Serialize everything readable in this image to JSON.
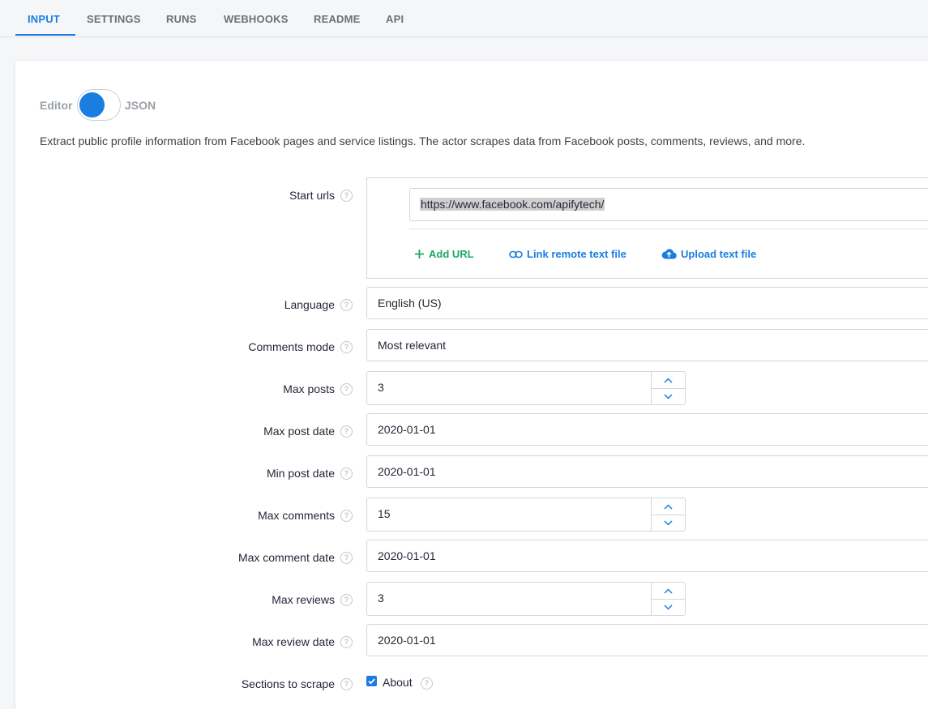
{
  "tabs": [
    {
      "label": "INPUT",
      "active": true
    },
    {
      "label": "SETTINGS",
      "active": false
    },
    {
      "label": "RUNS",
      "active": false
    },
    {
      "label": "WEBHOOKS",
      "active": false
    },
    {
      "label": "README",
      "active": false
    },
    {
      "label": "API",
      "active": false
    }
  ],
  "mode_toggle": {
    "left_label": "Editor",
    "right_label": "JSON",
    "selected": "Editor"
  },
  "description": "Extract public profile information from Facebook pages and service listings. The actor scrapes data from Facebook posts, comments, reviews, and more.",
  "help_icon_glyph": "?",
  "start_urls": {
    "label": "Start urls",
    "urls": [
      "https://www.facebook.com/apifytech/"
    ],
    "actions": {
      "add_url": "Add URL",
      "link_remote": "Link remote text file",
      "upload": "Upload text file"
    }
  },
  "fields": {
    "language": {
      "label": "Language",
      "value": "English (US)"
    },
    "comments_mode": {
      "label": "Comments mode",
      "value": "Most relevant"
    },
    "max_posts": {
      "label": "Max posts",
      "value": "3"
    },
    "max_post_date": {
      "label": "Max post date",
      "value": "2020-01-01"
    },
    "min_post_date": {
      "label": "Min post date",
      "value": "2020-01-01"
    },
    "max_comments": {
      "label": "Max comments",
      "value": "15"
    },
    "max_comment_date": {
      "label": "Max comment date",
      "value": "2020-01-01"
    },
    "max_reviews": {
      "label": "Max reviews",
      "value": "3"
    },
    "max_review_date": {
      "label": "Max review date",
      "value": "2020-01-01"
    }
  },
  "sections": {
    "label": "Sections to scrape",
    "options": [
      {
        "label": "About",
        "checked": true
      }
    ]
  },
  "colors": {
    "accent": "#1a7de0",
    "add_url_green": "#1ba864",
    "link_blue": "#1a7de0"
  }
}
